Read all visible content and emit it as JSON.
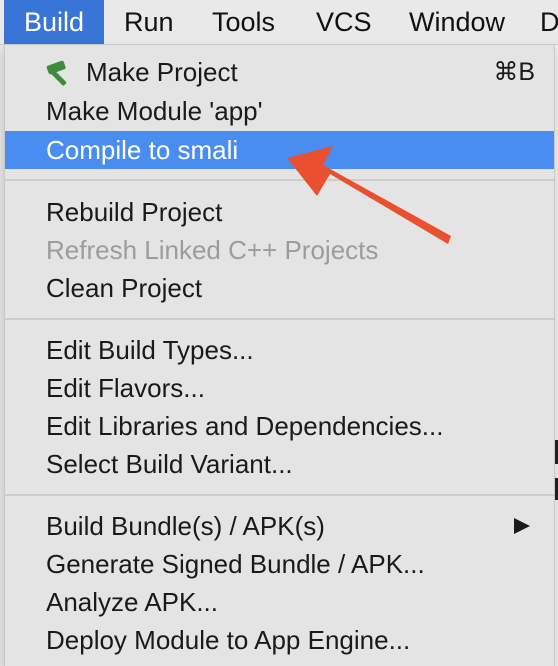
{
  "menubar": {
    "items": [
      {
        "label": "Build"
      },
      {
        "label": "Run"
      },
      {
        "label": "Tools"
      },
      {
        "label": "VCS"
      },
      {
        "label": "Window"
      },
      {
        "label": "D"
      }
    ]
  },
  "build_menu": {
    "groups": [
      [
        {
          "label": "Make Project",
          "shortcut": "⌘B",
          "icon": "hammer-icon"
        },
        {
          "label": "Make Module 'app'"
        },
        {
          "label": "Compile to smali",
          "state": "highlighted"
        }
      ],
      [
        {
          "label": "Rebuild Project"
        },
        {
          "label": "Refresh Linked C++ Projects",
          "state": "disabled"
        },
        {
          "label": "Clean Project"
        }
      ],
      [
        {
          "label": "Edit Build Types..."
        },
        {
          "label": "Edit Flavors..."
        },
        {
          "label": "Edit Libraries and Dependencies..."
        },
        {
          "label": "Select Build Variant..."
        }
      ],
      [
        {
          "label": "Build Bundle(s) / APK(s)",
          "submenu": true
        },
        {
          "label": "Generate Signed Bundle / APK..."
        },
        {
          "label": "Analyze APK..."
        },
        {
          "label": "Deploy Module to App Engine..."
        }
      ]
    ]
  },
  "colors": {
    "menubar_active": "#3875d7",
    "highlight": "#4a8df0",
    "annotation_arrow": "#e8502f",
    "hammer_icon": "#3d8b3d"
  }
}
